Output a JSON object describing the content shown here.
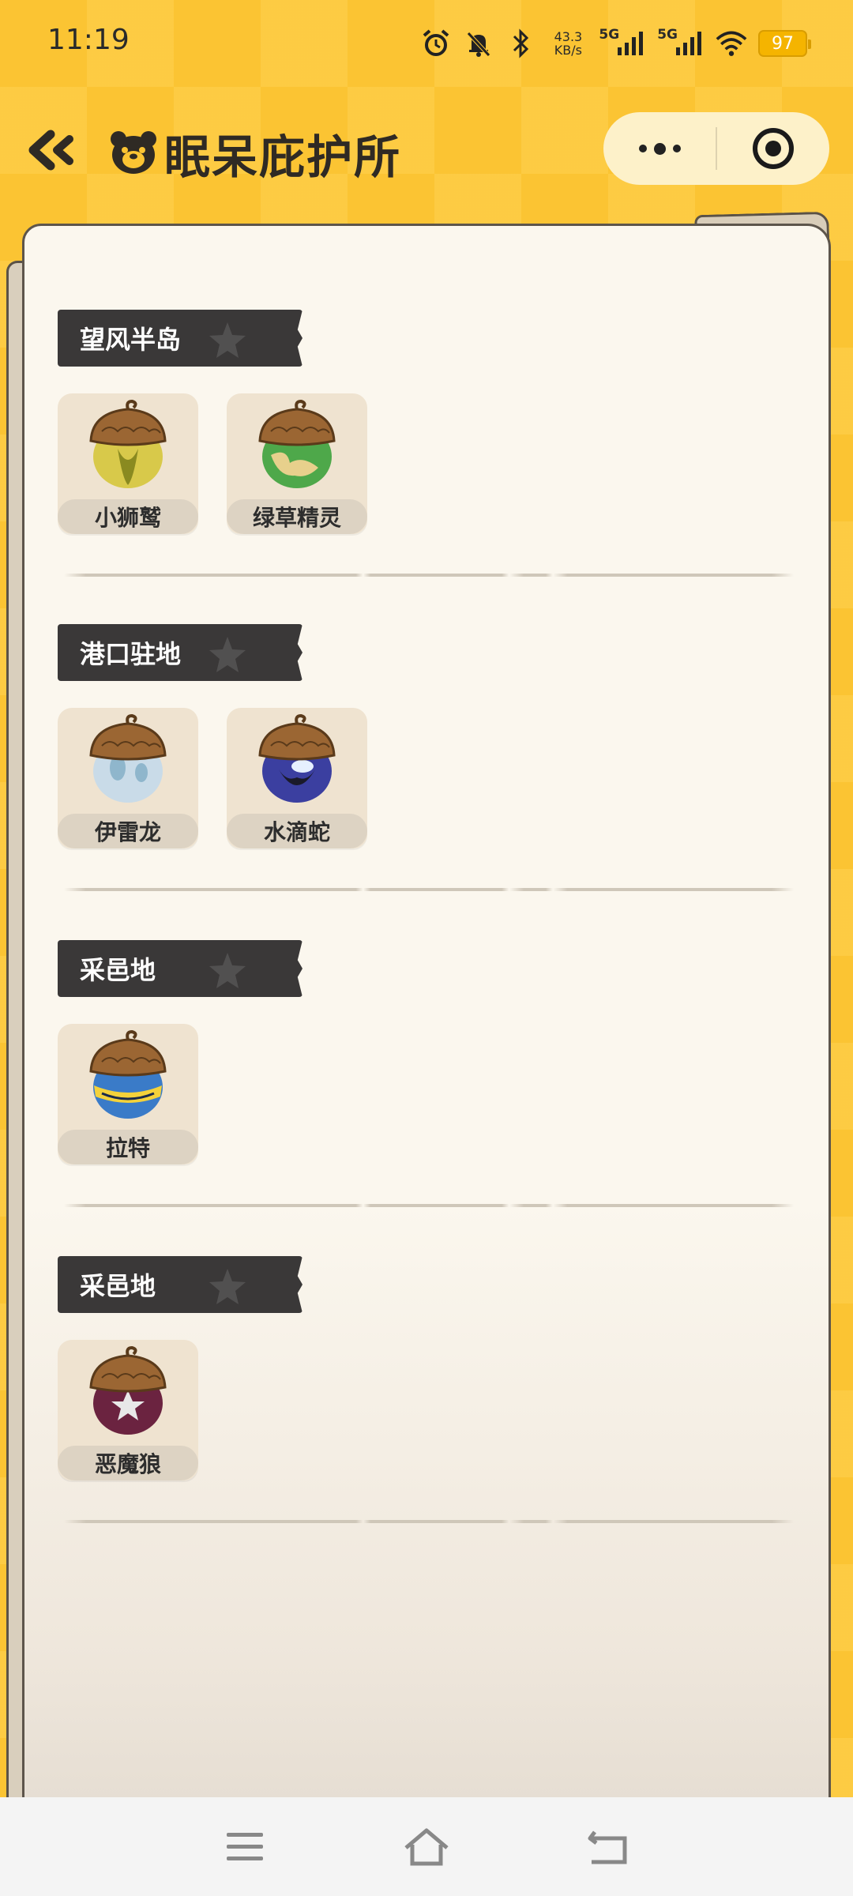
{
  "status_bar": {
    "time": "11:19",
    "net_speed_value": "43.3",
    "net_speed_unit": "KB/s",
    "signal1_label": "5G",
    "signal2_label": "5G",
    "battery": "97",
    "icons": [
      "alarm-icon",
      "mute-bell-icon",
      "bluetooth-icon",
      "signal-icon",
      "signal-icon",
      "wifi-icon",
      "battery-icon"
    ]
  },
  "header": {
    "title": "眠呆庇护所",
    "back_icon": "double-chevron-left-icon",
    "logo_icon": "bear-face-icon",
    "more_icon": "more-dots-icon",
    "close_icon": "target-circle-icon"
  },
  "sections": [
    {
      "tag": "望风半岛",
      "items": [
        {
          "label": "小狮鹫",
          "pet_color": "#d8c94a",
          "accent": "#8a8a20"
        },
        {
          "label": "绿草精灵",
          "pet_color": "#4ea84a",
          "accent": "#e7d08c"
        }
      ]
    },
    {
      "tag": "港口驻地",
      "items": [
        {
          "label": "伊雷龙",
          "pet_color": "#c9dbe8",
          "accent": "#8fb6cc"
        },
        {
          "label": "水滴蛇",
          "pet_color": "#3b3fa0",
          "accent": "#1a1a2a"
        }
      ]
    },
    {
      "tag": "采邑地",
      "items": [
        {
          "label": "拉特",
          "pet_color": "#3a7bc8",
          "accent": "#f4d23a"
        }
      ]
    },
    {
      "tag": "采邑地",
      "items": [
        {
          "label": "恶魔狼",
          "pet_color": "#6b2340",
          "accent": "#e8e8e8"
        }
      ]
    }
  ],
  "navbar": {
    "icons": [
      "menu-icon",
      "home-icon",
      "back-icon"
    ]
  }
}
